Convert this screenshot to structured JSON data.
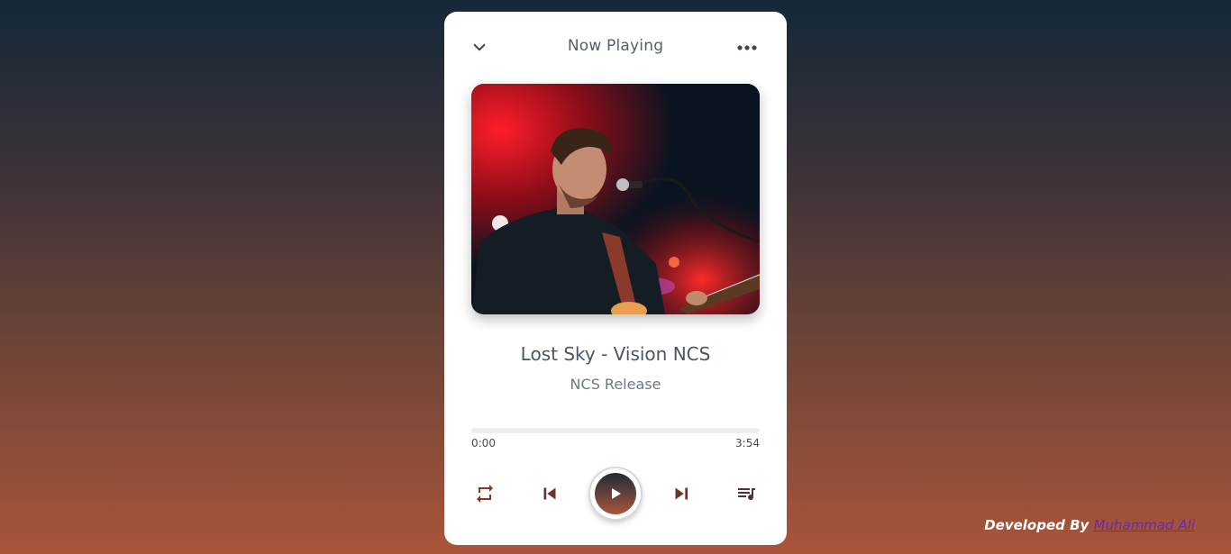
{
  "header": {
    "title": "Now Playing",
    "collapse_icon": "chevron-down-icon",
    "more_icon": "more-horizontal-icon"
  },
  "track": {
    "title": "Lost Sky - Vision NCS",
    "artist": "NCS Release",
    "current_time": "0:00",
    "duration": "3:54",
    "progress_fraction": 0
  },
  "controls": {
    "repeat_icon": "repeat-icon",
    "previous_icon": "skip-previous-icon",
    "play_icon": "play-icon",
    "next_icon": "skip-next-icon",
    "playlist_icon": "playlist-icon"
  },
  "footer": {
    "credit_prefix": "Developed By ",
    "author_link": "Muhammad Ali"
  },
  "colors": {
    "accent": "#a9553a",
    "dark": "#1e2c38",
    "text": "#4a5562"
  }
}
